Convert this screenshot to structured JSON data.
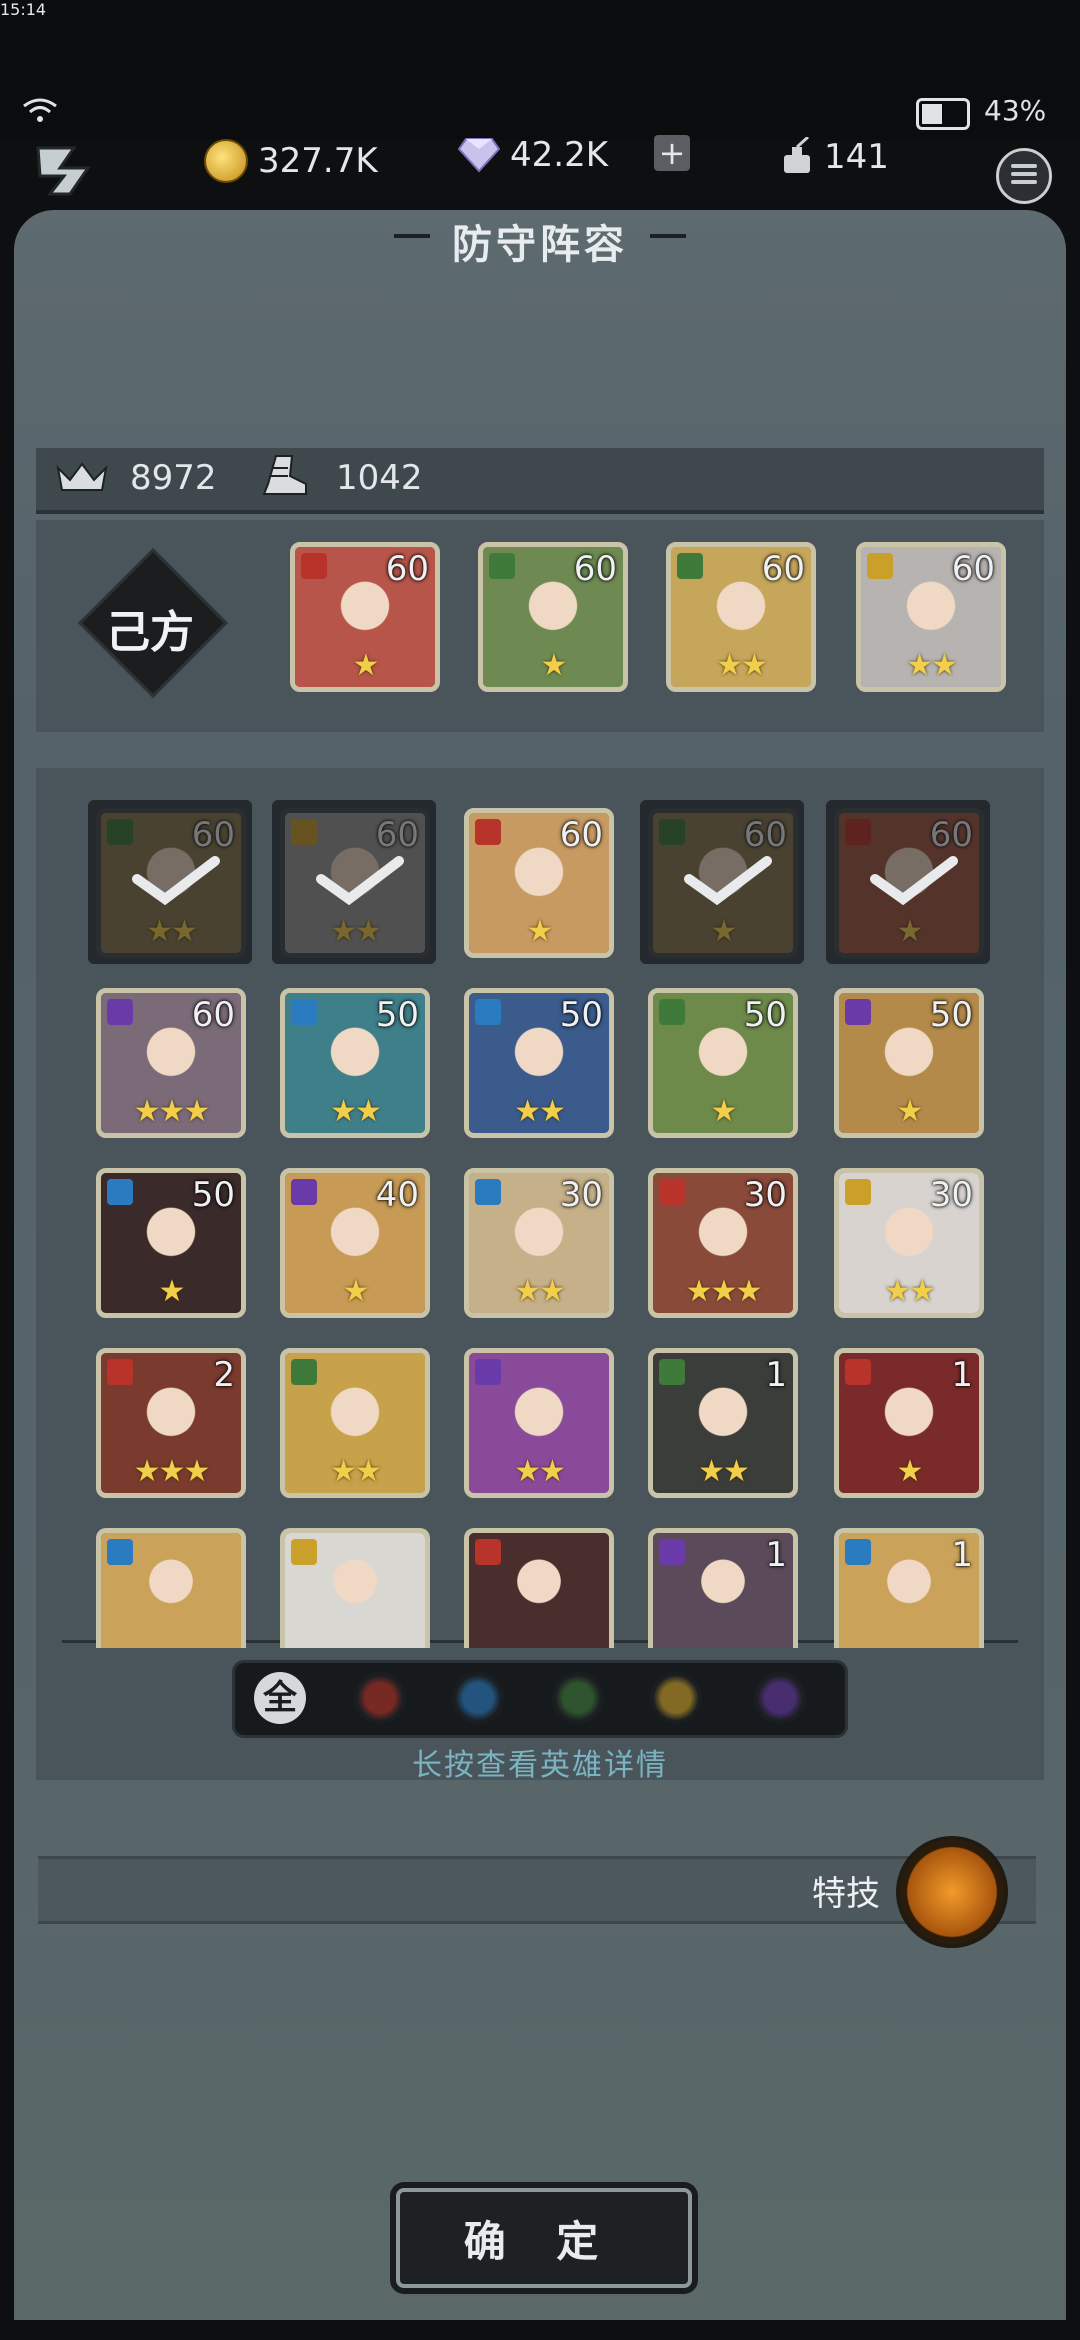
{
  "status_bar": {
    "time": "15:14",
    "battery": "43%"
  },
  "resources": {
    "gold": "327.7K",
    "gems": "42.2K",
    "plus_label": "+",
    "stamina": "141"
  },
  "title": "防守阵容",
  "stats": {
    "crown_value": "8972",
    "boots_value": "1042"
  },
  "lineup": {
    "side_label": "己方",
    "heroes": [
      {
        "level": "60",
        "stars": "★",
        "element": "fire",
        "color": "#b7554a"
      },
      {
        "level": "60",
        "stars": "★",
        "element": "nature",
        "color": "#6e8a52"
      },
      {
        "level": "60",
        "stars": "★★",
        "element": "nature",
        "color": "#c6a65a"
      },
      {
        "level": "60",
        "stars": "★★",
        "element": "light",
        "color": "#b7b3b0"
      }
    ]
  },
  "roster": [
    [
      {
        "level": "60",
        "stars": "★★",
        "element": "nature",
        "selected": true,
        "color": "#8b7a52"
      },
      {
        "level": "60",
        "stars": "★★",
        "element": "light",
        "selected": true,
        "color": "#9c9a98"
      },
      {
        "level": "60",
        "stars": "★",
        "element": "fire",
        "selected": false,
        "color": "#c79a62"
      },
      {
        "level": "60",
        "stars": "★",
        "element": "nature",
        "selected": true,
        "color": "#8b7a52"
      },
      {
        "level": "60",
        "stars": "★",
        "element": "fire",
        "selected": true,
        "color": "#a35a46"
      }
    ],
    [
      {
        "level": "60",
        "stars": "★★★",
        "element": "dark",
        "selected": false,
        "color": "#7b6a78"
      },
      {
        "level": "50",
        "stars": "★★",
        "element": "water",
        "selected": false,
        "color": "#3e7f8a"
      },
      {
        "level": "50",
        "stars": "★★",
        "element": "water",
        "selected": false,
        "color": "#3a5b8c"
      },
      {
        "level": "50",
        "stars": "★",
        "element": "nature",
        "selected": false,
        "color": "#6d8a4a"
      },
      {
        "level": "50",
        "stars": "★",
        "element": "dark",
        "selected": false,
        "color": "#b48a4a"
      }
    ],
    [
      {
        "level": "50",
        "stars": "★",
        "element": "water",
        "selected": false,
        "color": "#3a2a2a"
      },
      {
        "level": "40",
        "stars": "★",
        "element": "dark",
        "selected": false,
        "color": "#c79a55"
      },
      {
        "level": "30",
        "stars": "★★",
        "element": "water",
        "selected": false,
        "color": "#c6b08a"
      },
      {
        "level": "30",
        "stars": "★★★",
        "element": "fire",
        "selected": false,
        "color": "#8a4a3a"
      },
      {
        "level": "30",
        "stars": "★★",
        "element": "light",
        "selected": false,
        "color": "#d8d3cf"
      }
    ],
    [
      {
        "level": "2",
        "stars": "★★★",
        "element": "fire",
        "selected": false,
        "color": "#7a3a2e"
      },
      {
        "level": "",
        "stars": "★★",
        "element": "nature",
        "selected": false,
        "color": "#c8a24a"
      },
      {
        "level": "",
        "stars": "★★",
        "element": "dark",
        "selected": false,
        "color": "#8a4a9a"
      },
      {
        "level": "1",
        "stars": "★★",
        "element": "nature",
        "selected": false,
        "color": "#3a3d3a"
      },
      {
        "level": "1",
        "stars": "★",
        "element": "fire",
        "selected": false,
        "color": "#7a2a2a"
      }
    ],
    [
      {
        "level": "",
        "stars": "",
        "element": "water",
        "selected": false,
        "color": "#caa25a"
      },
      {
        "level": "",
        "stars": "",
        "element": "light",
        "selected": false,
        "color": "#d9d7d2"
      },
      {
        "level": "",
        "stars": "",
        "element": "fire",
        "selected": false,
        "color": "#4a2e2e"
      },
      {
        "level": "1",
        "stars": "",
        "element": "dark",
        "selected": false,
        "color": "#5a4a5a"
      },
      {
        "level": "1",
        "stars": "",
        "element": "water",
        "selected": false,
        "color": "#caa25a"
      }
    ]
  ],
  "filters": {
    "all_label": "全",
    "elements": [
      "fire",
      "water",
      "nature",
      "light",
      "dark"
    ]
  },
  "hint": "长按查看英雄详情",
  "skill": {
    "label": "特技"
  },
  "confirm_label": "确 定",
  "colors": {
    "fire": "#b8332a",
    "water": "#2a7bbf",
    "nature": "#3f7a3a",
    "light": "#caa02a",
    "dark": "#6a3aa8"
  }
}
